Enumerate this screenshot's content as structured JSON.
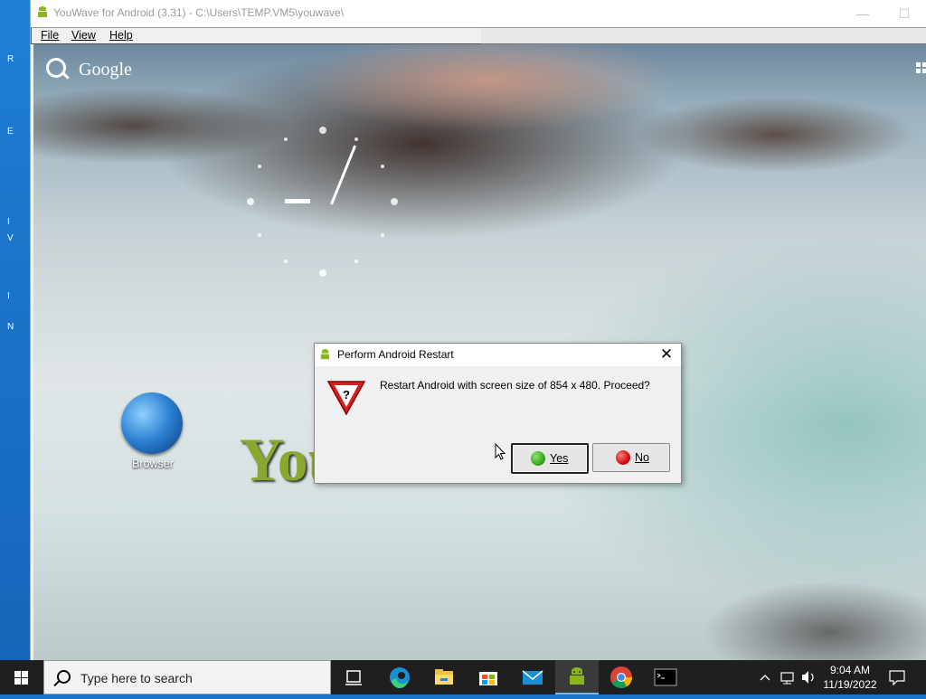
{
  "desktop": {
    "edge_glyphs": [
      "R",
      "E",
      "I",
      "V",
      "I",
      "N"
    ]
  },
  "window": {
    "title": "YouWave for Android (3.31) - C:\\Users\\TEMP.VM5\\youwave\\",
    "menu": [
      "File",
      "View",
      "Help"
    ]
  },
  "android": {
    "search_label": "Google",
    "browser_label": "Browser",
    "logo_text": "You"
  },
  "dialog": {
    "title": "Perform Android Restart",
    "message": "Restart Android with screen size of 854 x 480. Proceed?",
    "yes_label": "Yes",
    "no_label": "No",
    "close_glyph": "✕"
  },
  "taskbar": {
    "search_placeholder": "Type here to search",
    "time": "9:04 AM",
    "date": "11/19/2022",
    "pinned": [
      "task-view",
      "edge",
      "file-explorer",
      "store",
      "mail",
      "youwave",
      "chrome",
      "terminal"
    ]
  },
  "colors": {
    "yes_ball": "#3aa81e",
    "no_ball": "#d01010",
    "taskbar": "#1f1f1f"
  }
}
